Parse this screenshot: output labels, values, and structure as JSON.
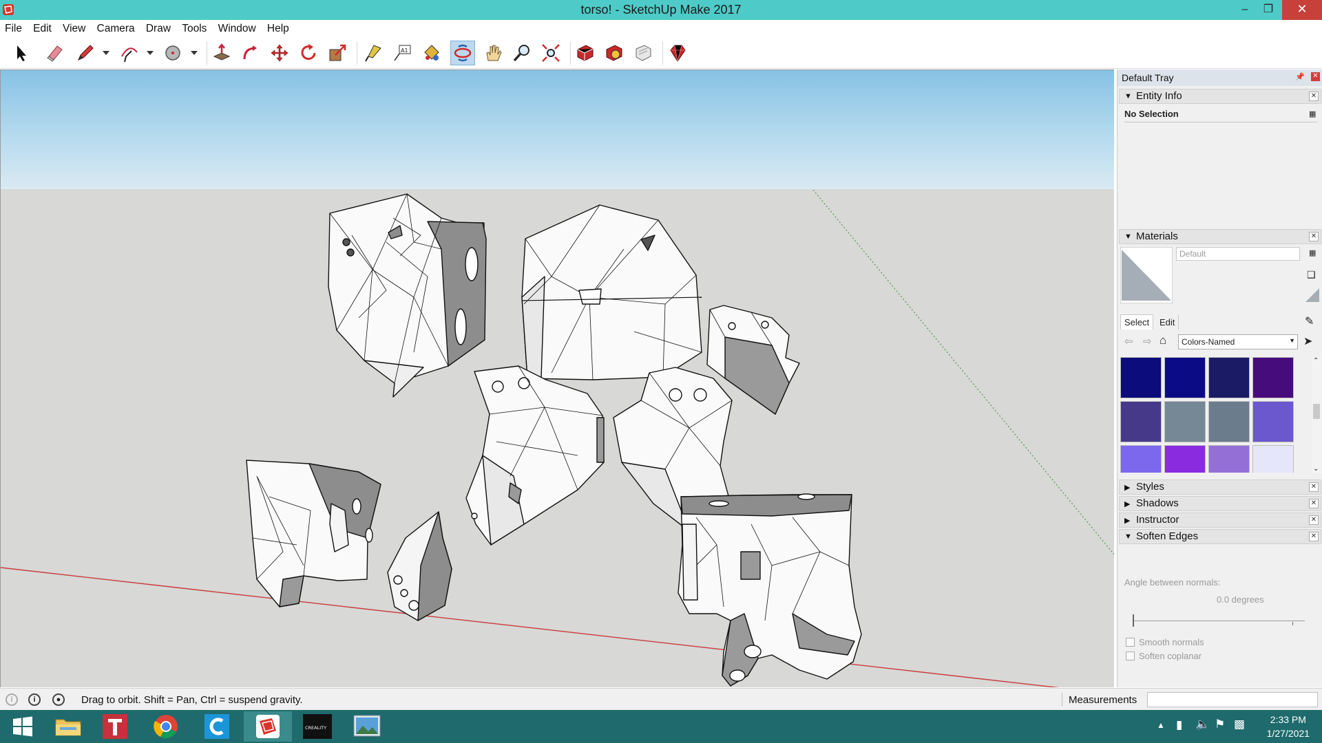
{
  "window": {
    "title": "torso! - SketchUp Make 2017",
    "minimize_icon": "minimize-icon",
    "maximize_icon": "maximize-icon",
    "close_icon": "close-icon"
  },
  "menu": [
    "File",
    "Edit",
    "View",
    "Camera",
    "Draw",
    "Tools",
    "Window",
    "Help"
  ],
  "toolbar": {
    "tools": [
      "select",
      "eraser",
      "line",
      "arc",
      "shapes",
      "push-pull",
      "follow-me",
      "move",
      "rotate",
      "scale",
      "tape-measure",
      "text",
      "paint-bucket",
      "orbit",
      "pan",
      "zoom",
      "zoom-extents",
      "3d-warehouse",
      "extension-warehouse",
      "layout",
      "extension-manager"
    ],
    "active": "orbit"
  },
  "tray": {
    "title": "Default Tray",
    "entity_info": {
      "label": "Entity Info",
      "value": "No Selection"
    },
    "materials": {
      "label": "Materials",
      "current_name": "Default",
      "tabs": [
        "Select",
        "Edit"
      ],
      "library": "Colors-Named",
      "swatches": [
        "#0c0c7a",
        "#0b0b85",
        "#1b1a64",
        "#470c7c",
        "#47398a",
        "#768896",
        "#6b7d8c",
        "#6a58cc",
        "#7c68ed",
        "#8a2be0",
        "#9470d6",
        "#e6e6fa",
        "#fbfbfb",
        "#dfc3db",
        "#bc8f8f",
        "#da70d6"
      ]
    },
    "panels": [
      "Styles",
      "Shadows",
      "Instructor",
      "Soften Edges"
    ],
    "soften_edges": {
      "angle_label": "Angle between normals:",
      "angle_value": "0.0  degrees",
      "smooth_normals": "Smooth normals",
      "soften_coplanar": "Soften coplanar"
    }
  },
  "status": {
    "message": "Drag to orbit. Shift = Pan, Ctrl = suspend gravity.",
    "measurements_label": "Measurements"
  },
  "taskbar": {
    "apps": [
      "windows-start",
      "file-explorer",
      "typora",
      "chrome",
      "cura",
      "sketchup",
      "creality",
      "photos"
    ],
    "active": "sketchup",
    "time": "2:33 PM",
    "date": "1/27/2021"
  }
}
